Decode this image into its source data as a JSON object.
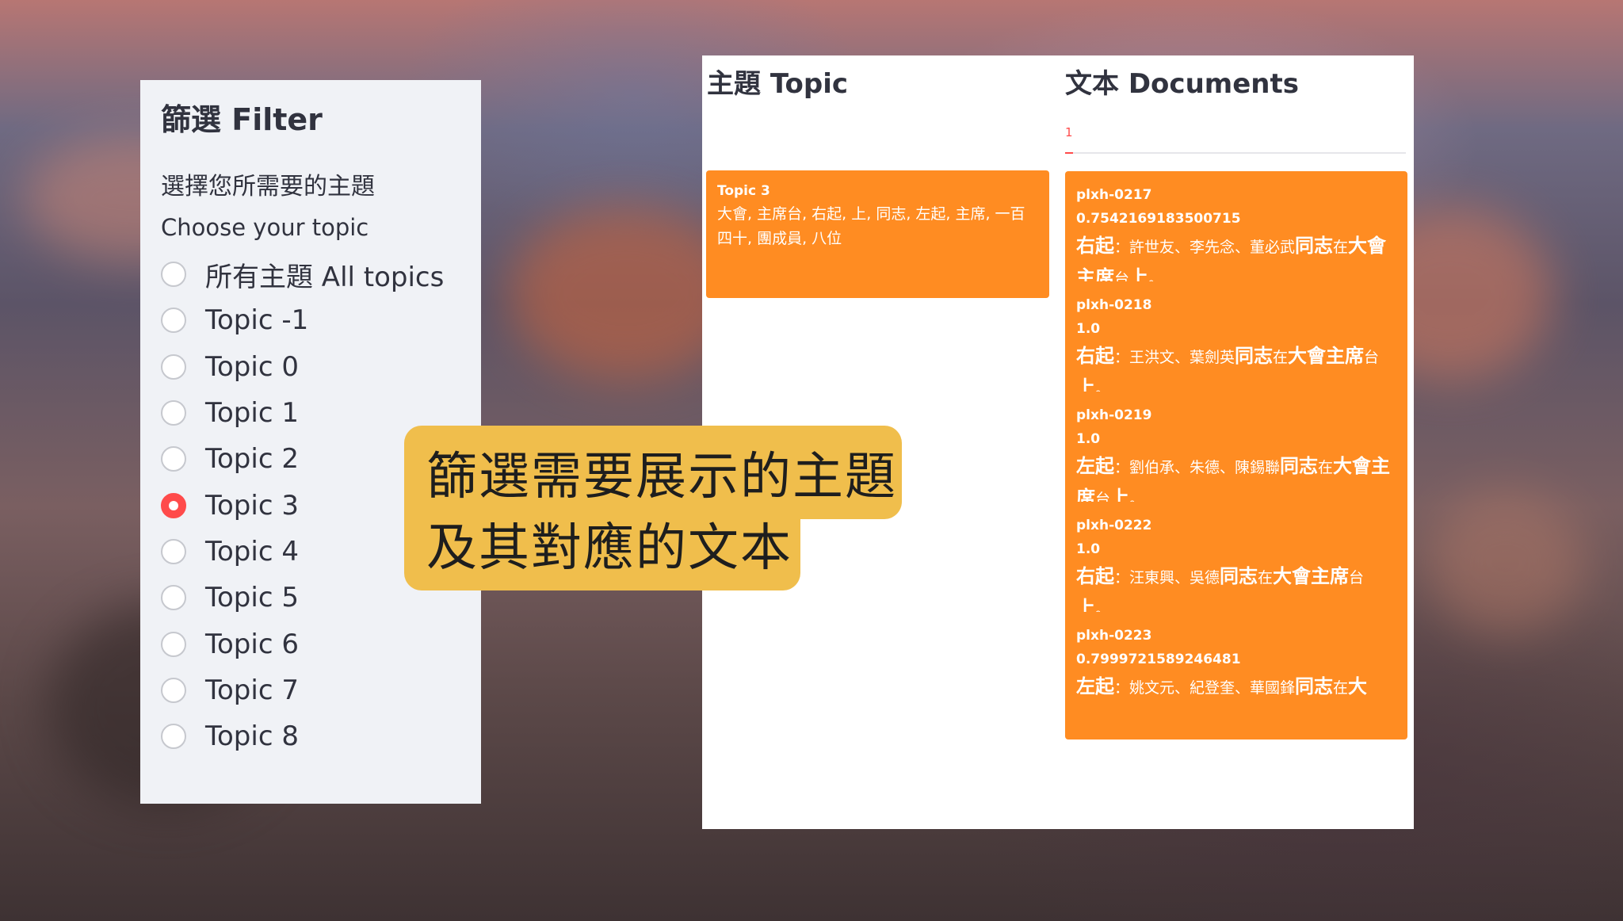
{
  "filter": {
    "title": "篩選 Filter",
    "desc_zh": "選擇您所需要的主題",
    "desc_en": "Choose your topic",
    "options": [
      {
        "label": "所有主題 All topics",
        "selected": false
      },
      {
        "label": "Topic -1",
        "selected": false
      },
      {
        "label": "Topic 0",
        "selected": false
      },
      {
        "label": "Topic 1",
        "selected": false
      },
      {
        "label": "Topic 2",
        "selected": false
      },
      {
        "label": "Topic 3",
        "selected": true
      },
      {
        "label": "Topic 4",
        "selected": false
      },
      {
        "label": "Topic 5",
        "selected": false
      },
      {
        "label": "Topic 6",
        "selected": false
      },
      {
        "label": "Topic 7",
        "selected": false
      },
      {
        "label": "Topic 8",
        "selected": false
      }
    ]
  },
  "topic_column": {
    "title": "主題 Topic",
    "card": {
      "name": "Topic 3",
      "words": "大會, 主席台, 右起, 上, 同志, 左起, 主席, 一百四十, 團成員, 八位"
    }
  },
  "docs_column": {
    "title": "文本 Documents",
    "tab": "1",
    "documents": [
      {
        "id": "plxh-0217",
        "score": "0.7542169183500715",
        "text": [
          {
            "t": "右起",
            "hl": true
          },
          {
            "t": "：許世友、李先念、董必武",
            "hl": false
          },
          {
            "t": "同志",
            "hl": true
          },
          {
            "t": "在",
            "hl": false
          },
          {
            "t": "大會主席",
            "hl": true
          },
          {
            "t": "台",
            "hl": false
          },
          {
            "t": "上",
            "hl": true
          },
          {
            "t": "。",
            "hl": false
          }
        ]
      },
      {
        "id": "plxh-0218",
        "score": "1.0",
        "text": [
          {
            "t": "右起",
            "hl": true
          },
          {
            "t": "：王洪文、葉劍英",
            "hl": false
          },
          {
            "t": "同志",
            "hl": true
          },
          {
            "t": "在",
            "hl": false
          },
          {
            "t": "大會主席",
            "hl": true
          },
          {
            "t": "台",
            "hl": false
          },
          {
            "t": "上",
            "hl": true
          },
          {
            "t": "。",
            "hl": false
          }
        ]
      },
      {
        "id": "plxh-0219",
        "score": "1.0",
        "text": [
          {
            "t": "左起",
            "hl": true
          },
          {
            "t": "：劉伯承、朱德、陳錫聯",
            "hl": false
          },
          {
            "t": "同志",
            "hl": true
          },
          {
            "t": "在",
            "hl": false
          },
          {
            "t": "大會主席",
            "hl": true
          },
          {
            "t": "台",
            "hl": false
          },
          {
            "t": "上",
            "hl": true
          },
          {
            "t": "。",
            "hl": false
          }
        ]
      },
      {
        "id": "plxh-0222",
        "score": "1.0",
        "text": [
          {
            "t": "右起",
            "hl": true
          },
          {
            "t": "：汪東興、吳德",
            "hl": false
          },
          {
            "t": "同志",
            "hl": true
          },
          {
            "t": "在",
            "hl": false
          },
          {
            "t": "大會主席",
            "hl": true
          },
          {
            "t": "台",
            "hl": false
          },
          {
            "t": "上",
            "hl": true
          },
          {
            "t": "。",
            "hl": false
          }
        ]
      },
      {
        "id": "plxh-0223",
        "score": "0.7999721589246481",
        "text": [
          {
            "t": "左起",
            "hl": true
          },
          {
            "t": "：姚文元、紀登奎、華國鋒",
            "hl": false
          },
          {
            "t": "同志",
            "hl": true
          },
          {
            "t": "在",
            "hl": false
          },
          {
            "t": "大",
            "hl": true
          }
        ]
      }
    ]
  },
  "callout": {
    "line1": "篩選需要展示的主題",
    "line2": "及其對應的文本"
  },
  "colors": {
    "accent_red": "#ff4b4b",
    "card_orange": "#ff8c22",
    "callout_yellow": "#f0be4c",
    "panel_gray": "#f0f2f6"
  }
}
